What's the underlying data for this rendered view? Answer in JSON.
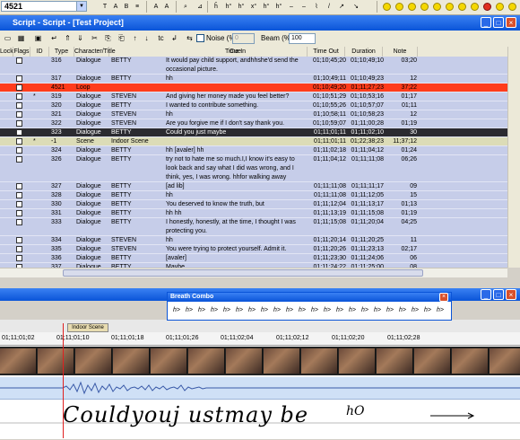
{
  "toolbar": {
    "id_value": "4521",
    "icons": [
      "text-format-icon",
      "italic-icon",
      "bold-icon",
      "align-icon",
      "text-size-icon",
      "italic-a-icon",
      "search-icon",
      "mark-icon",
      "special-char-icon"
    ],
    "symbols": [
      "hO",
      "hO",
      "hO",
      "hO",
      "hO",
      "hO",
      "hO",
      "hO",
      "hO",
      "hO",
      "hO",
      "hO",
      "hO",
      "hO"
    ]
  },
  "script_window": {
    "title": "Script - Script - [Test Project]",
    "noise_label": "Noise (%)",
    "noise_value": "0",
    "beam_label": "Beam (%)",
    "beam_value": "100",
    "columns": [
      "Lock",
      "Flags",
      "ID",
      "Type",
      "Character/Title",
      "Cue",
      "Time In",
      "Time Out",
      "Duration",
      "Note"
    ],
    "rows": [
      {
        "id": "316",
        "type": "Dialogue",
        "character": "BETTY",
        "cue": "It would pay child support, andhhshe'd send the occasional picture.",
        "time_in": "01;10;45;20",
        "time_out": "01;10;49;10",
        "duration": "03;20",
        "flag": "",
        "style": "tall2"
      },
      {
        "id": "317",
        "type": "Dialogue",
        "character": "BETTY",
        "cue": "hh",
        "time_in": "01;10;49;11",
        "time_out": "01;10;49;23",
        "duration": "12",
        "flag": "",
        "style": ""
      },
      {
        "id": "4521",
        "type": "Loop",
        "character": "",
        "cue": "",
        "time_in": "01;10;49;20",
        "time_out": "01;11;27;23",
        "duration": "37;22",
        "flag": "",
        "style": "loop"
      },
      {
        "id": "319",
        "type": "Dialogue",
        "character": "STEVEN",
        "cue": "And giving her money made you feel better?",
        "time_in": "01;10;51;29",
        "time_out": "01;10;53;16",
        "duration": "01;17",
        "flag": "*",
        "style": ""
      },
      {
        "id": "320",
        "type": "Dialogue",
        "character": "BETTY",
        "cue": "I wanted to contribute something.",
        "time_in": "01;10;55;26",
        "time_out": "01;10;57;07",
        "duration": "01;11",
        "flag": "",
        "style": ""
      },
      {
        "id": "321",
        "type": "Dialogue",
        "character": "STEVEN",
        "cue": "hh",
        "time_in": "01;10;58;11",
        "time_out": "01;10;58;23",
        "duration": "12",
        "flag": "",
        "style": ""
      },
      {
        "id": "322",
        "type": "Dialogue",
        "character": "STEVEN",
        "cue": "Are you forgive me if I don't say thank you.",
        "time_in": "01;10;59;07",
        "time_out": "01;11;00;28",
        "duration": "01;19",
        "flag": "",
        "style": ""
      },
      {
        "id": "323",
        "type": "Dialogue",
        "character": "BETTY",
        "cue": "Could you just maybe",
        "time_in": "01;11;01;11",
        "time_out": "01;11;02;10",
        "duration": "30",
        "flag": "",
        "style": "dark"
      },
      {
        "id": "-1",
        "type": "Scene",
        "character": "Indoor Scene",
        "cue": "",
        "time_in": "01;11;01;11",
        "time_out": "01;22;38;23",
        "duration": "11;37;12",
        "flag": "*",
        "style": "scene"
      },
      {
        "id": "324",
        "type": "Dialogue",
        "character": "BETTY",
        "cue": "hh [avaler] hh",
        "time_in": "01;11;02;18",
        "time_out": "01;11;04;12",
        "duration": "01;24",
        "flag": "",
        "style": ""
      },
      {
        "id": "326",
        "type": "Dialogue",
        "character": "BETTY",
        "cue": "try not to hate me so much.I,I know it's easy to look back and say what I did was wrong, and I think, yes, I was wrong. hhfor walking away",
        "time_in": "01;11;04;12",
        "time_out": "01;11;11;08",
        "duration": "06;26",
        "flag": "",
        "style": "tall3"
      },
      {
        "id": "327",
        "type": "Dialogue",
        "character": "BETTY",
        "cue": "[ad lib]",
        "time_in": "01;11;11;08",
        "time_out": "01;11;11;17",
        "duration": "09",
        "flag": "",
        "style": ""
      },
      {
        "id": "328",
        "type": "Dialogue",
        "character": "BETTY",
        "cue": "hh",
        "time_in": "01;11;11;08",
        "time_out": "01;11;12;05",
        "duration": "15",
        "flag": "",
        "style": ""
      },
      {
        "id": "330",
        "type": "Dialogue",
        "character": "BETTY",
        "cue": "You deserved to know the truth, but",
        "time_in": "01;11;12;04",
        "time_out": "01;11;13;17",
        "duration": "01;13",
        "flag": "",
        "style": ""
      },
      {
        "id": "331",
        "type": "Dialogue",
        "character": "BETTY",
        "cue": "hh hh",
        "time_in": "01;11;13;19",
        "time_out": "01;11;15;08",
        "duration": "01;19",
        "flag": "",
        "style": ""
      },
      {
        "id": "333",
        "type": "Dialogue",
        "character": "BETTY",
        "cue": "I honestly, honestly, at the time, I thought I was protecting you.",
        "time_in": "01;11;15;08",
        "time_out": "01;11;20;04",
        "duration": "04;25",
        "flag": "",
        "style": "tall2"
      },
      {
        "id": "334",
        "type": "Dialogue",
        "character": "STEVEN",
        "cue": "hh",
        "time_in": "01;11;20;14",
        "time_out": "01;11;20;25",
        "duration": "11",
        "flag": "",
        "style": ""
      },
      {
        "id": "335",
        "type": "Dialogue",
        "character": "STEVEN",
        "cue": "You were trying to protect yourself. Admit it.",
        "time_in": "01;11;20;26",
        "time_out": "01;11;23;13",
        "duration": "02;17",
        "flag": "",
        "style": ""
      },
      {
        "id": "336",
        "type": "Dialogue",
        "character": "BETTY",
        "cue": "[avaler]",
        "time_in": "01;11;23;30",
        "time_out": "01;11;24;06",
        "duration": "06",
        "flag": "",
        "style": ""
      },
      {
        "id": "337",
        "type": "Dialogue",
        "character": "BETTY",
        "cue": "Maybe",
        "time_in": "01;11;24;22",
        "time_out": "01;11;25;00",
        "duration": "08",
        "flag": "",
        "style": ""
      }
    ]
  },
  "breath_combo": {
    "title": "Breath Combo",
    "symbols": [
      "h>",
      "h>",
      "h>",
      "h>",
      "h>",
      "h>",
      "h>",
      "h>",
      "h>",
      "h>",
      "h>",
      "h>",
      "h>",
      "h>",
      "h>",
      "h>",
      "h>",
      "h>",
      "h>",
      "h>",
      "h>",
      "h>"
    ]
  },
  "rhythmo": {
    "scene_label": "Indoor Scene",
    "timecodes": [
      "01;11;01;02",
      "01;11;01;10",
      "01;11;01;18",
      "01;11;01;26",
      "01;11;02;04",
      "01;11;02;12",
      "01;11;02;20",
      "01;11;02;28"
    ],
    "band_text": "Couldyouj ustmay be",
    "band_extra": "hO"
  }
}
